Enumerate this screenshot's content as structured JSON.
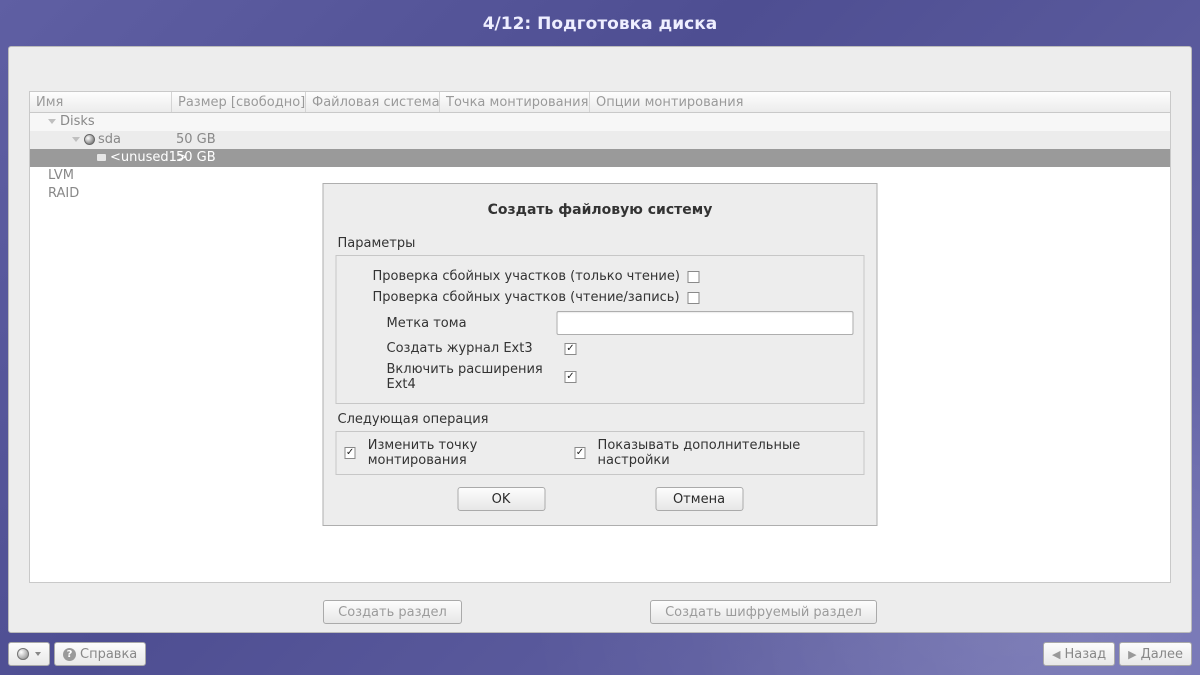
{
  "title": "4/12: Подготовка диска",
  "tree": {
    "columns": [
      "Имя",
      "Размер [свободно]",
      "Файловая система",
      "Точка монтирования",
      "Опции монтирования"
    ],
    "rows": {
      "disks_label": "Disks",
      "sda_name": "sda",
      "sda_size": "50 GB",
      "unused_name": "<unused1>",
      "unused_size": "50 GB",
      "lvm_label": "LVM",
      "raid_label": "RAID"
    }
  },
  "dialog": {
    "title": "Создать файловую систему",
    "params_label": "Параметры",
    "check_ro": "Проверка сбойных участков (только чтение)",
    "check_rw": "Проверка сбойных участков (чтение/запись)",
    "volume_label": "Метка тома",
    "volume_label_value": "",
    "ext3_journal": "Создать журнал Ext3",
    "ext4_ext": "Включить расширения Ext4",
    "checks": {
      "ro": false,
      "rw": false,
      "ext3": true,
      "ext4": true
    },
    "next_op_label": "Следующая операция",
    "change_mount": "Изменить точку монтирования",
    "show_adv": "Показывать дополнительные настройки",
    "next_checks": {
      "change_mount": true,
      "show_adv": true
    },
    "ok": "OK",
    "cancel": "Отмена"
  },
  "panel_buttons": {
    "create_partition": "Создать раздел",
    "create_encrypted": "Создать шифруемый раздел"
  },
  "nav": {
    "help": "Справка",
    "back": "Назад",
    "next": "Далее"
  }
}
